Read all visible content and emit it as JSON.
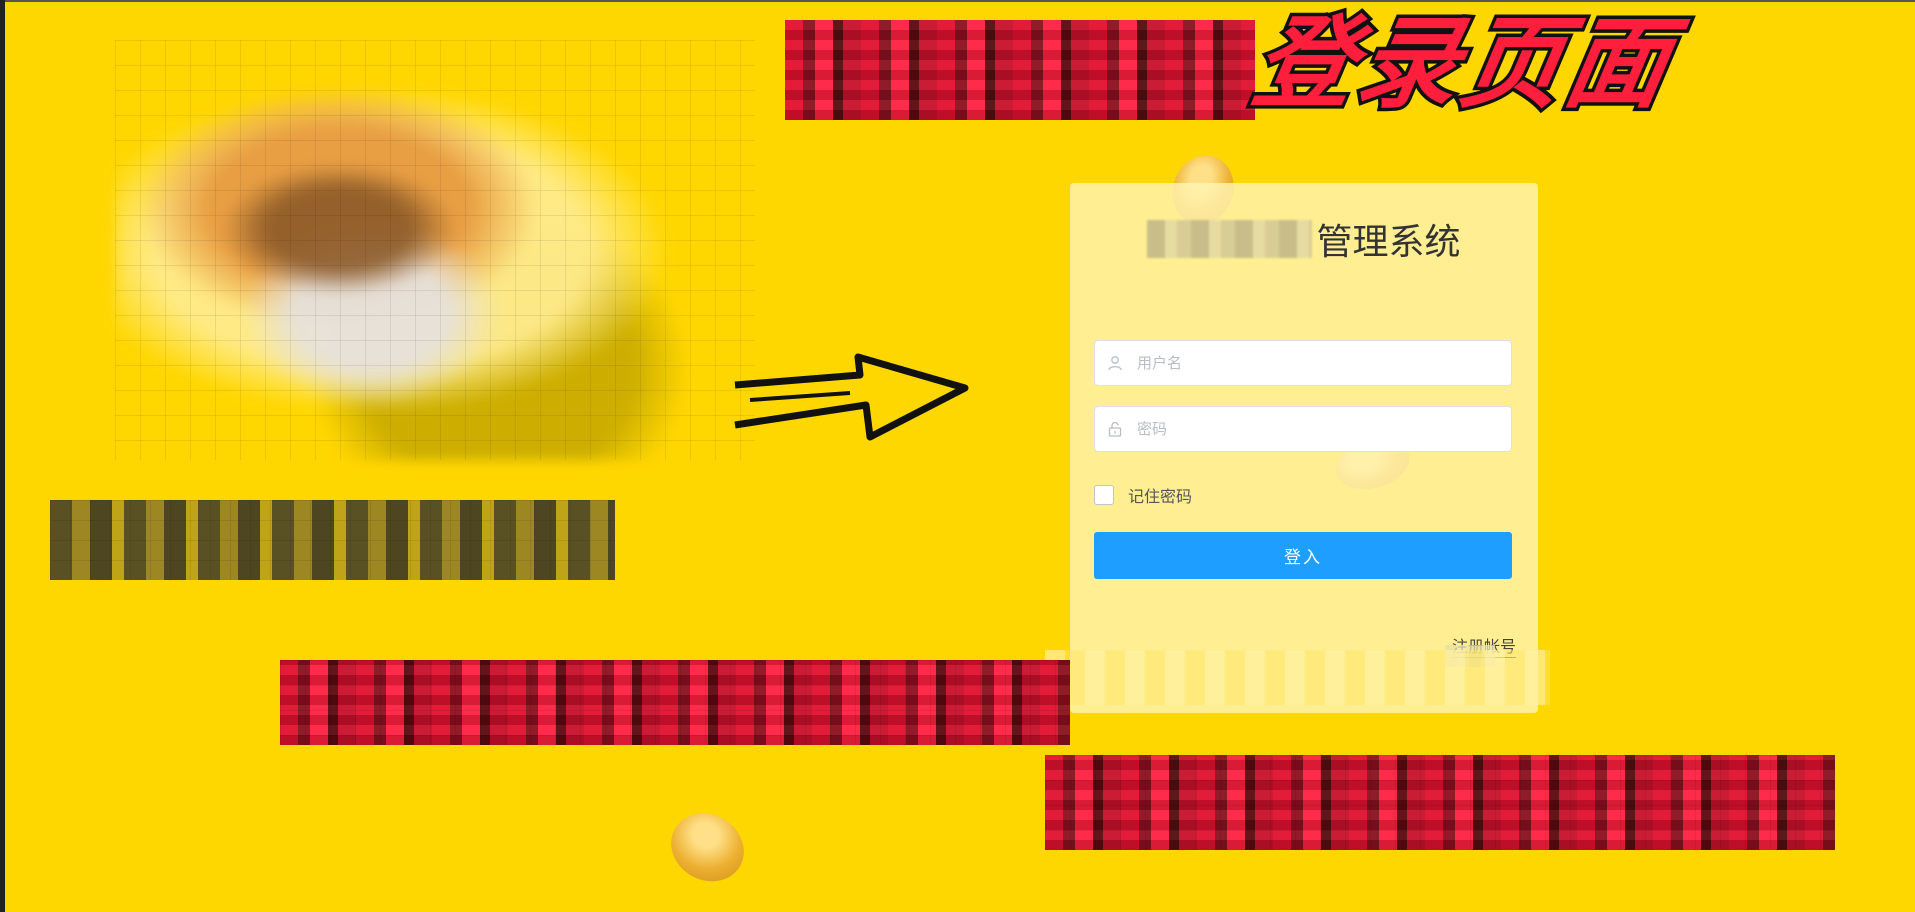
{
  "headline": {
    "visible_text": "登录页面"
  },
  "login": {
    "title_suffix": "管理系统",
    "username_placeholder": "用户名",
    "password_placeholder": "密码",
    "remember_label": "记住密码",
    "login_button": "登入",
    "register_link": "注册帐号"
  },
  "colors": {
    "background": "#FFD700",
    "headline_red": "#ff1f3d",
    "button_blue": "#1e9fff",
    "card_bg": "#fff4b2"
  },
  "icons": {
    "username": "user-icon",
    "password": "lock-icon",
    "arrow": "arrow-right-icon"
  }
}
